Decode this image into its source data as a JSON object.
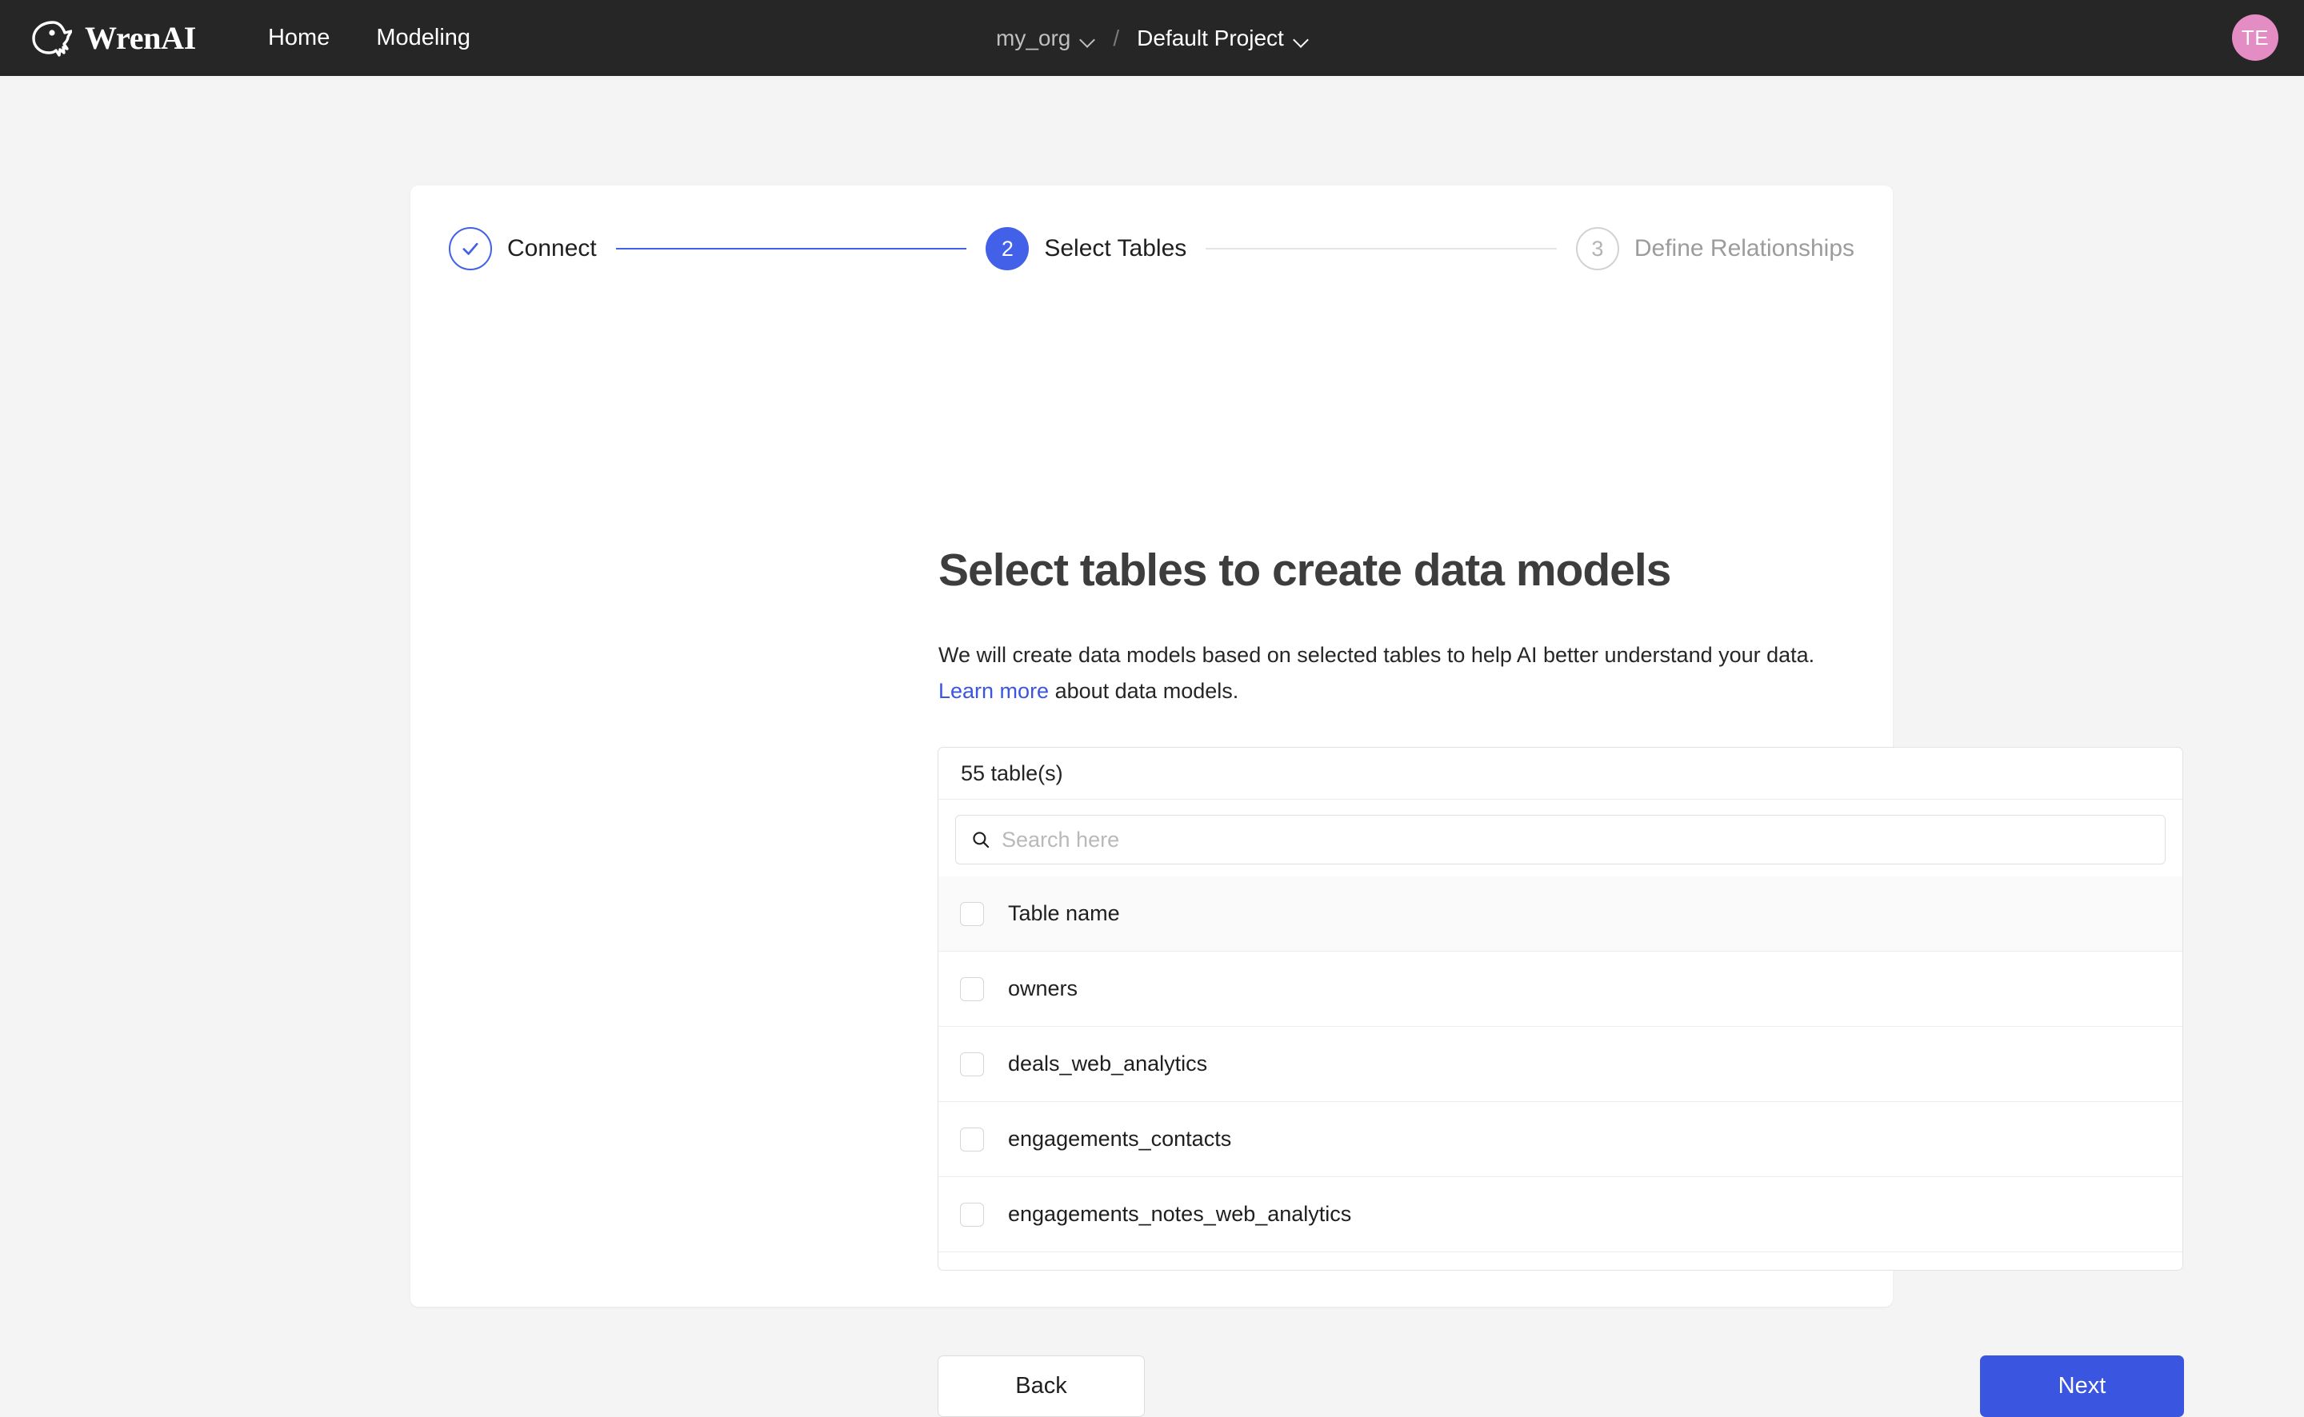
{
  "topbar": {
    "brand_name": "WrenAI",
    "brand_logo_icon": "wren-bird-icon",
    "nav": [
      {
        "label": "Home"
      },
      {
        "label": "Modeling"
      }
    ],
    "breadcrumb": {
      "org": "my_org",
      "separator": "/",
      "project": "Default Project",
      "org_chevron_icon": "chevron-down-icon",
      "project_chevron_icon": "chevron-down-icon"
    },
    "avatar": {
      "initials": "TE",
      "color": "#e48cc4"
    }
  },
  "stepper": {
    "steps": [
      {
        "number": "1",
        "label": "Connect",
        "state": "done",
        "icon": "check-icon"
      },
      {
        "number": "2",
        "label": "Select Tables",
        "state": "active"
      },
      {
        "number": "3",
        "label": "Define Relationships",
        "state": "todo"
      }
    ],
    "active_color": "#4260e8",
    "inactive_color": "#d2d2d2"
  },
  "main": {
    "title": "Select tables to create data models",
    "description": "We will create data models based on selected tables to help AI better understand your data.",
    "learn_more_link": "Learn more",
    "learn_more_suffix": " about data models."
  },
  "picker": {
    "count_label": "55 table(s)",
    "search": {
      "placeholder": "Search here",
      "value": "",
      "icon": "search-icon"
    },
    "column_header": "Table name",
    "rows": [
      {
        "name": "owners",
        "checked": false
      },
      {
        "name": "deals_web_analytics",
        "checked": false
      },
      {
        "name": "engagements_contacts",
        "checked": false
      },
      {
        "name": "engagements_notes_web_analytics",
        "checked": false
      }
    ]
  },
  "footer": {
    "back_label": "Back",
    "next_label": "Next",
    "next_color": "#3a55e0"
  }
}
